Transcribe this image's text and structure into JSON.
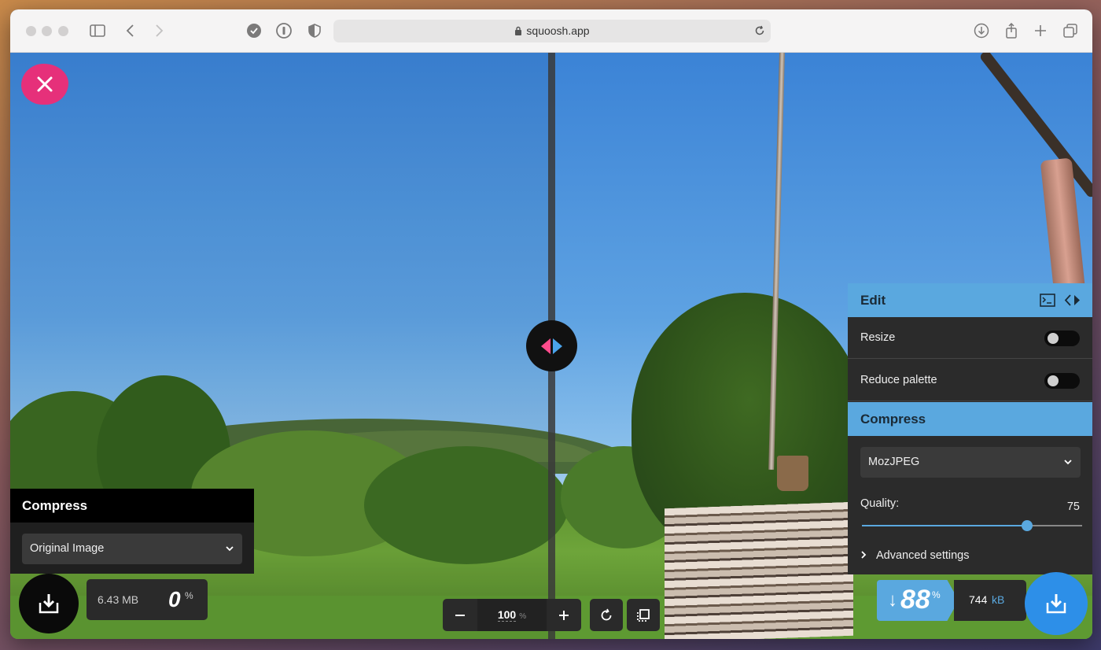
{
  "browser": {
    "url": "squoosh.app"
  },
  "left_panel": {
    "header": "Compress",
    "method": "Original Image",
    "size_value": "6.43 MB",
    "percent": "0",
    "percent_sign": "%"
  },
  "zoom": {
    "value": "100",
    "unit": "%"
  },
  "right_panel": {
    "edit_header": "Edit",
    "resize_label": "Resize",
    "resize_on": false,
    "reduce_palette_label": "Reduce palette",
    "reduce_palette_on": false,
    "compress_header": "Compress",
    "codec": "MozJPEG",
    "quality_label": "Quality:",
    "quality_value": "75",
    "quality_fraction": 0.75,
    "advanced_label": "Advanced settings"
  },
  "result": {
    "saving_arrow": "↓",
    "saving_percent": "88",
    "saving_sign": "%",
    "size_value": "744",
    "size_unit": "kB"
  },
  "colors": {
    "accent_blue": "#5aa8df",
    "accent_pink": "#e6307a"
  }
}
